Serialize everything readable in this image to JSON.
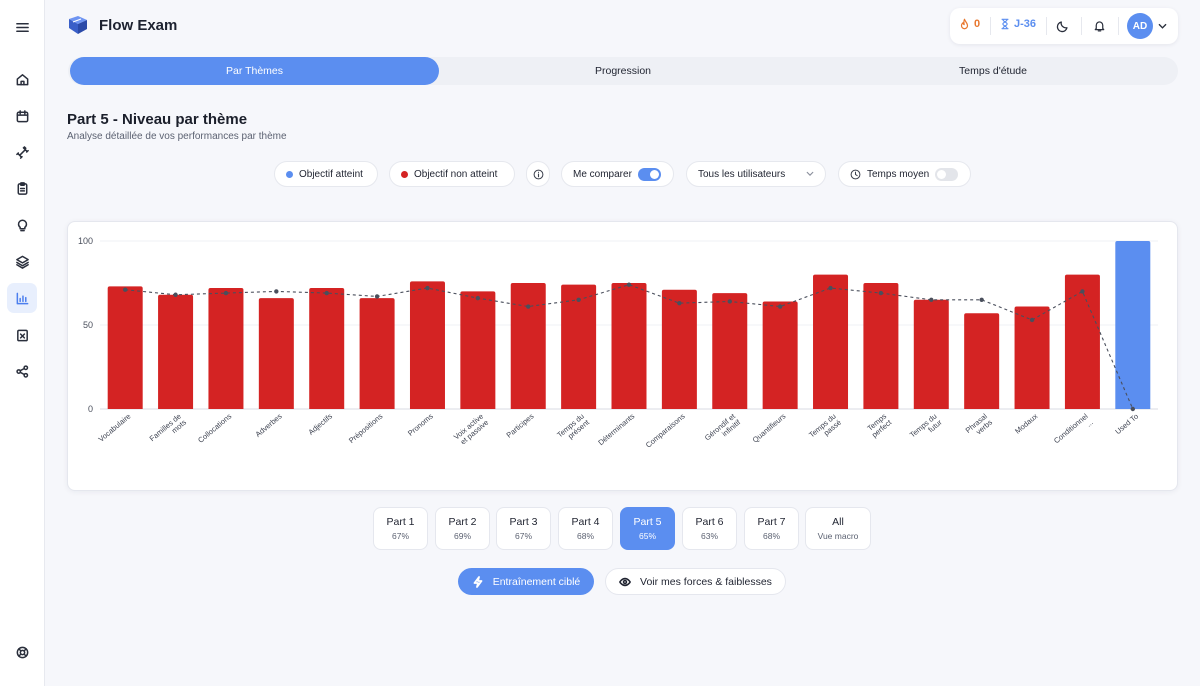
{
  "app": {
    "name": "Flow Exam"
  },
  "header": {
    "streak": "0",
    "countdown": "J-36",
    "avatar_initials": "AD"
  },
  "sidebar": {
    "items": [
      {
        "name": "menu-icon"
      },
      {
        "name": "home-icon"
      },
      {
        "name": "calendar-icon"
      },
      {
        "name": "dumbbell-icon"
      },
      {
        "name": "clipboard-icon"
      },
      {
        "name": "lightbulb-icon"
      },
      {
        "name": "layers-icon"
      },
      {
        "name": "bar-chart-icon",
        "active": true
      },
      {
        "name": "exam-icon"
      },
      {
        "name": "share-icon"
      },
      {
        "name": "help-icon"
      }
    ]
  },
  "tabs": [
    {
      "label": "Par Thèmes",
      "active": true
    },
    {
      "label": "Progression",
      "active": false
    },
    {
      "label": "Temps d'étude",
      "active": false
    }
  ],
  "page": {
    "title": "Part 5 - Niveau par thème",
    "subtitle": "Analyse détaillée de vos performances par thème"
  },
  "controls": {
    "legend_met": "Objectif atteint",
    "legend_not_met": "Objectif non atteint",
    "compare_label": "Me comparer",
    "compare_on": true,
    "users_select": "Tous les utilisateurs",
    "avg_time_label": "Temps moyen",
    "avg_time_on": false
  },
  "colors": {
    "accent": "#5b8ef0",
    "met": "#5b8ef0",
    "not_met": "#d42323",
    "streak": "#e8772e",
    "avg_line": "#4a4f5c"
  },
  "chart_data": {
    "type": "bar",
    "ylim": [
      0,
      100
    ],
    "yticks": [
      0,
      50,
      100
    ],
    "categories": [
      [
        "Vocabulaire"
      ],
      [
        "Familles de",
        "mots"
      ],
      [
        "Collocations"
      ],
      [
        "Adverbes"
      ],
      [
        "Adjectifs"
      ],
      [
        "Prépositions"
      ],
      [
        "Pronoms"
      ],
      [
        "Voix active",
        "et passive"
      ],
      [
        "Participes"
      ],
      [
        "Temps du",
        "présent"
      ],
      [
        "Déterminants"
      ],
      [
        "Comparaisons"
      ],
      [
        "Gérondif et",
        "infinitif"
      ],
      [
        "Quantifieurs"
      ],
      [
        "Temps du",
        "passé"
      ],
      [
        "Temps",
        "perfect"
      ],
      [
        "Temps du",
        "futur"
      ],
      [
        "Phrasal",
        "verbs"
      ],
      [
        "Modaux"
      ],
      [
        "Conditionnel",
        "..."
      ],
      [
        "Used To"
      ]
    ],
    "series": [
      {
        "values": [
          73,
          68,
          72,
          66,
          72,
          66,
          76,
          70,
          75,
          74,
          75,
          71,
          69,
          64,
          80,
          75,
          65,
          57,
          61,
          80,
          100
        ],
        "status": [
          "not_met",
          "not_met",
          "not_met",
          "not_met",
          "not_met",
          "not_met",
          "not_met",
          "not_met",
          "not_met",
          "not_met",
          "not_met",
          "not_met",
          "not_met",
          "not_met",
          "not_met",
          "not_met",
          "not_met",
          "not_met",
          "not_met",
          "not_met",
          "met"
        ]
      },
      {
        "type": "line",
        "values": [
          71,
          68,
          69,
          70,
          69,
          67,
          72,
          66,
          61,
          65,
          74,
          63,
          64,
          61,
          72,
          69,
          65,
          65,
          53,
          70,
          0
        ]
      }
    ]
  },
  "parts": [
    {
      "name": "Part 1",
      "pct": "67%"
    },
    {
      "name": "Part 2",
      "pct": "69%"
    },
    {
      "name": "Part 3",
      "pct": "67%"
    },
    {
      "name": "Part 4",
      "pct": "68%"
    },
    {
      "name": "Part 5",
      "pct": "65%",
      "active": true
    },
    {
      "name": "Part 6",
      "pct": "63%"
    },
    {
      "name": "Part 7",
      "pct": "68%"
    },
    {
      "name": "All",
      "pct": "Vue macro"
    }
  ],
  "actions": {
    "targeted_training": "Entraînement ciblé",
    "strengths": "Voir mes forces & faiblesses"
  }
}
